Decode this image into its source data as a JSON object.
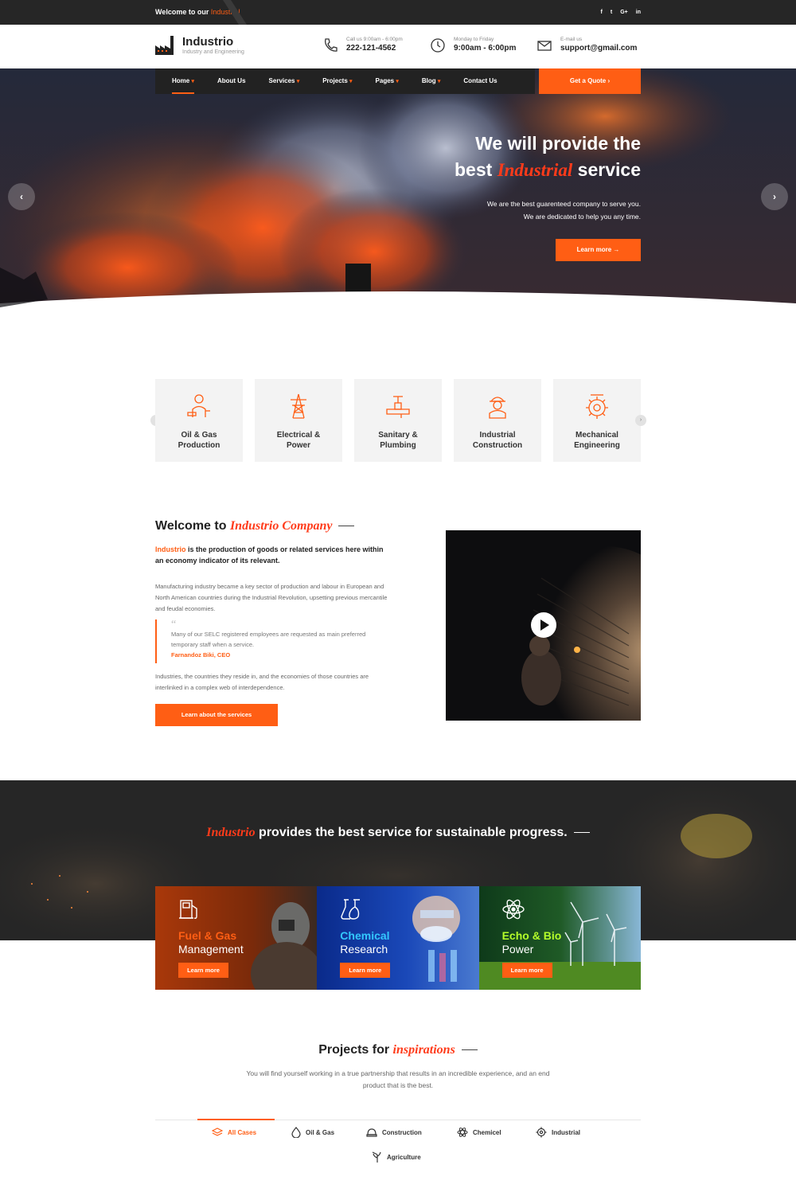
{
  "topbar": {
    "welcome_prefix": "Welcome to our ",
    "welcome_highlight": "Industrial",
    "socials": [
      "f",
      "t",
      "G+",
      "in"
    ]
  },
  "logo": {
    "name": "Industrio",
    "tagline": "Industry and Engineering"
  },
  "header_info": [
    {
      "icon": "phone-icon",
      "label": "Call us 9:00am - 6:00pm",
      "value": "222-121-4562"
    },
    {
      "icon": "clock-icon",
      "label": "Monday to Friday",
      "value": "9:00am - 6:00pm"
    },
    {
      "icon": "mail-icon",
      "label": "E-mail us",
      "value": "support@gmail.com"
    }
  ],
  "nav": [
    {
      "label": "Home",
      "dropdown": true,
      "active": true
    },
    {
      "label": "About Us",
      "dropdown": false
    },
    {
      "label": "Services",
      "dropdown": true
    },
    {
      "label": "Projects",
      "dropdown": true
    },
    {
      "label": "Pages",
      "dropdown": true
    },
    {
      "label": "Blog",
      "dropdown": true
    },
    {
      "label": "Contact Us",
      "dropdown": false
    }
  ],
  "quote_button": "Get a Quote",
  "hero": {
    "title_line1": "We will provide the",
    "title_pre": "best ",
    "title_em": "Industrial",
    "title_post": " service",
    "sub1": "We are the best guarenteed company to serve you.",
    "sub2": "We are dedicated to help you any time.",
    "button": "Learn more",
    "prev": "‹",
    "next": "›",
    "slides": 3,
    "active_slide": 3
  },
  "services": [
    {
      "line1": "Oil & Gas",
      "line2": "Production",
      "icon": "oil-worker-icon"
    },
    {
      "line1": "Electrical &",
      "line2": "Power",
      "icon": "power-tower-icon"
    },
    {
      "line1": "Sanitary &",
      "line2": "Plumbing",
      "icon": "plumbing-icon"
    },
    {
      "line1": "Industrial",
      "line2": "Construction",
      "icon": "construction-worker-icon"
    },
    {
      "line1": "Mechanical",
      "line2": "Engineering",
      "icon": "gear-icon"
    }
  ],
  "welcome": {
    "title_pre": "Welcome to ",
    "title_em": "Industrio Company",
    "lead_hl": "Industrio",
    "lead_rest": " is the production of goods or related services here within an economy indicator of its relevant.",
    "para1": "Manufacturing industry became a key sector of production and labour in European and North American countries during the Industrial Revolution, upsetting previous mercantile and feudal economies.",
    "quote": "Many of our SELC registered employees are requested as main preferred temporary staff when a service.",
    "quote_author": "Farnandoz Biki, CEO",
    "para2": "Industries, the countries they reside in, and the economies of those countries are interlinked in a complex web of interdependence.",
    "button": "Learn about the services"
  },
  "dark": {
    "title_em": "Industrio",
    "title_rest": " provides the best service for sustainable progress."
  },
  "cards": [
    {
      "t1": "Fuel & Gas",
      "t2": "Management",
      "button": "Learn more",
      "color": "#ff5e14",
      "icon": "fuel-pump-icon"
    },
    {
      "t1": "Chemical",
      "t2": "Research",
      "button": "Learn more",
      "color": "#33c8ff",
      "icon": "flask-icon"
    },
    {
      "t1": "Echo & Bio",
      "t2": "Power",
      "button": "Learn more",
      "color": "#b5ff2a",
      "icon": "atom-icon"
    }
  ],
  "projects": {
    "title_pre": "Projects for ",
    "title_em": "inspirations",
    "sub": "You will find yourself working in a true partnership that results in an incredible experience, and an end product that is the best.",
    "tabs": [
      {
        "label": "All Cases",
        "icon": "layers-icon",
        "active": true
      },
      {
        "label": "Oil & Gas",
        "icon": "drop-icon"
      },
      {
        "label": "Construction",
        "icon": "helmet-icon"
      },
      {
        "label": "Chemicel",
        "icon": "atom-icon"
      },
      {
        "label": "Industrial",
        "icon": "gear-icon"
      },
      {
        "label": "Agriculture",
        "icon": "wheat-icon"
      }
    ]
  },
  "colors": {
    "accent": "#ff5e14",
    "dark": "#222222"
  }
}
